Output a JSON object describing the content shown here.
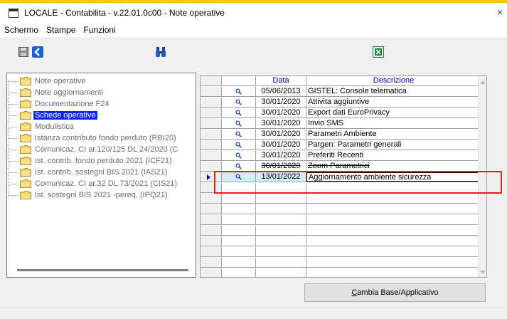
{
  "window": {
    "app_title": "LOCALE - Contabilita - v.22.01.0c00 - Note operative",
    "close_glyph": "×"
  },
  "menu": [
    {
      "label": "Schermo"
    },
    {
      "label": "Stampe"
    },
    {
      "label": "Funzioni"
    }
  ],
  "toolbar": {
    "icons": [
      "save-icon",
      "back-arrow-icon",
      "binoculars-icon",
      "excel-icon"
    ]
  },
  "tree": {
    "items": [
      {
        "label": "Note operative",
        "selected": false
      },
      {
        "label": "Note aggiornamenti",
        "selected": false
      },
      {
        "label": "Documentazione F24",
        "selected": false
      },
      {
        "label": "Schede operative",
        "selected": true
      },
      {
        "label": "Modulistica",
        "selected": false
      },
      {
        "label": "Istanza contributo fondo perduto (RBI20)",
        "selected": false
      },
      {
        "label": "Comunicaz. CI ar.120/125 DL 24/2020 (C",
        "selected": false
      },
      {
        "label": "Ist. contrib. fondo perduto 2021 (ICF21)",
        "selected": false
      },
      {
        "label": "Ist. contrib. sostegni BIS 2021 (IAS21)",
        "selected": false
      },
      {
        "label": "Comunicaz. CI ar.32 DL 73/2021 (CIS21)",
        "selected": false
      },
      {
        "label": "Ist. sostegni BIS 2021 -pereq. (IPQ21)",
        "selected": false
      }
    ]
  },
  "grid": {
    "columns": {
      "data": "Data",
      "descrizione": "Descrizione"
    },
    "rows": [
      {
        "data": "05/06/2013",
        "descrizione": "GISTEL: Console telematica"
      },
      {
        "data": "30/01/2020",
        "descrizione": "Attivita aggiuntive"
      },
      {
        "data": "30/01/2020",
        "descrizione": "Export dati EuroPrivacy"
      },
      {
        "data": "30/01/2020",
        "descrizione": "Invio SMS"
      },
      {
        "data": "30/01/2020",
        "descrizione": "Parametri Ambiente"
      },
      {
        "data": "30/01/2020",
        "descrizione": "Pargen: Parametri generali"
      },
      {
        "data": "30/01/2020",
        "descrizione": "Preferiti Recenti"
      },
      {
        "data": "30/01/2020",
        "descrizione": "Zoom Parametrici"
      },
      {
        "data": "13/01/2022",
        "descrizione": "Aggiornamento ambiente sicurezza"
      }
    ],
    "current_row": 9,
    "empty_rows": 9
  },
  "buttons": {
    "cambia_prefix": "C",
    "cambia_rest": "ambia Base/Applicativo"
  },
  "colors": {
    "highlight_box": "#e02020",
    "selected_tree_bg": "#0a24ff",
    "header_text": "#0000c8",
    "current_row_bg": "#ccf0f5"
  }
}
